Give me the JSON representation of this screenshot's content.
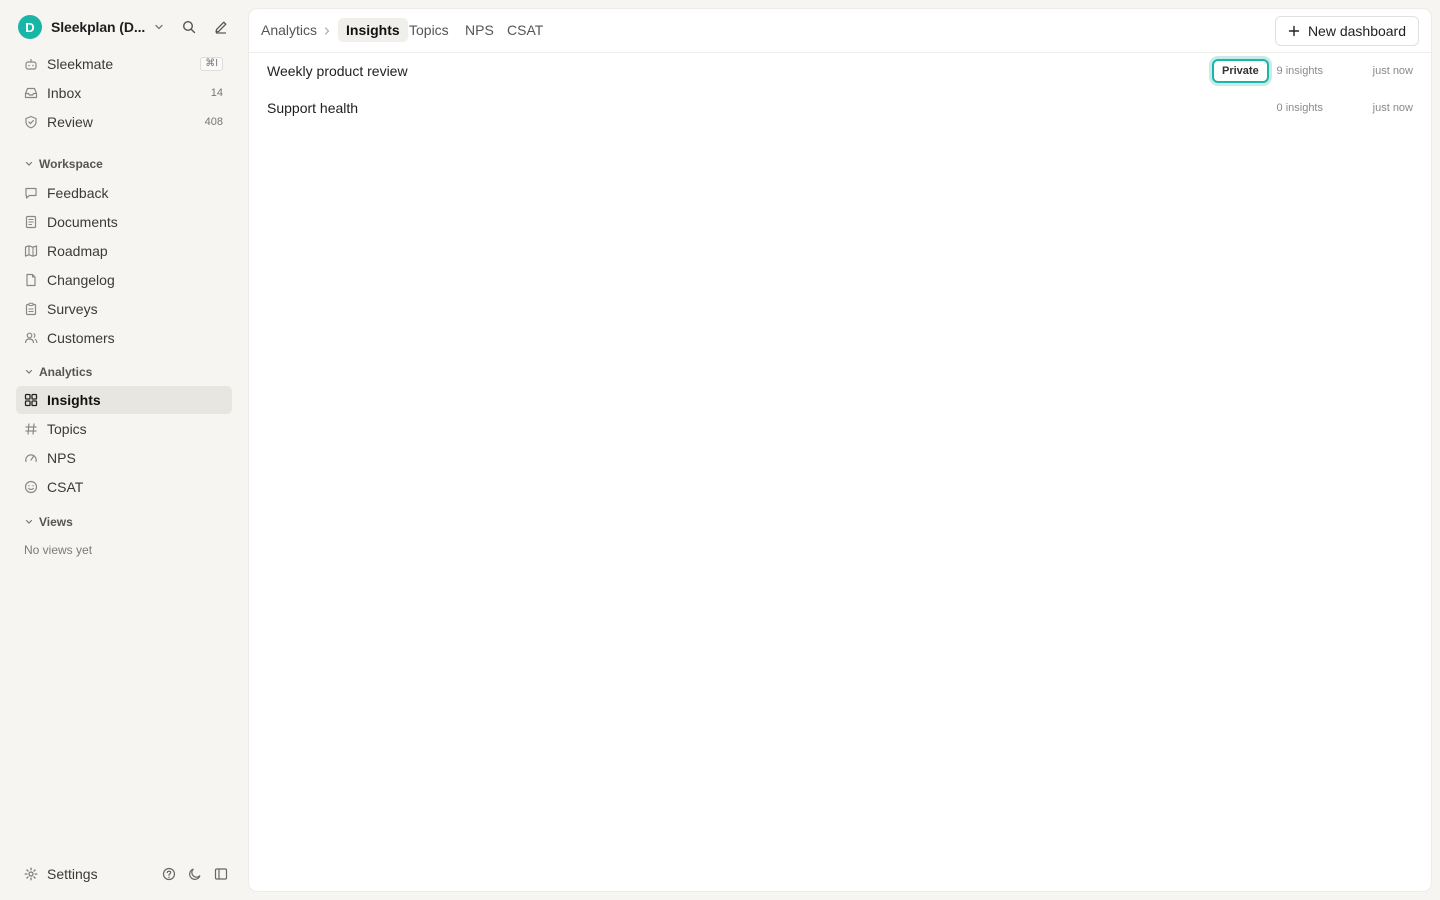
{
  "workspace": {
    "avatar_letter": "D",
    "name": "Sleekplan (D...",
    "accent": "#19b5a6"
  },
  "sidebar": {
    "top_items": [
      {
        "label": "Sleekmate",
        "shortcut": "⌘I",
        "icon": "bot-icon"
      },
      {
        "label": "Inbox",
        "count": "14",
        "icon": "inbox-icon"
      },
      {
        "label": "Review",
        "count": "408",
        "icon": "shield-check-icon"
      }
    ],
    "sections": {
      "workspace": "Workspace",
      "analytics": "Analytics",
      "views": "Views"
    },
    "workspace_items": [
      {
        "label": "Feedback",
        "icon": "message-square-icon"
      },
      {
        "label": "Documents",
        "icon": "book-icon"
      },
      {
        "label": "Roadmap",
        "icon": "map-icon"
      },
      {
        "label": "Changelog",
        "icon": "file-icon"
      },
      {
        "label": "Surveys",
        "icon": "clipboard-icon"
      },
      {
        "label": "Customers",
        "icon": "users-icon"
      }
    ],
    "analytics_items": [
      {
        "label": "Insights",
        "icon": "grid-icon",
        "active": true
      },
      {
        "label": "Topics",
        "icon": "hash-icon"
      },
      {
        "label": "NPS",
        "icon": "gauge-icon"
      },
      {
        "label": "CSAT",
        "icon": "smile-icon"
      }
    ],
    "views_empty": "No views yet",
    "settings_label": "Settings"
  },
  "header": {
    "breadcrumb_root": "Analytics",
    "tabs": [
      "Insights",
      "Topics",
      "NPS",
      "CSAT"
    ],
    "active_tab": "Insights",
    "new_button_label": "New dashboard"
  },
  "dashboards": [
    {
      "title": "Weekly product review",
      "badge": "Private",
      "insights": "9 insights",
      "updated": "just now"
    },
    {
      "title": "Support health",
      "badge": "",
      "insights": "0 insights",
      "updated": "just now"
    }
  ]
}
